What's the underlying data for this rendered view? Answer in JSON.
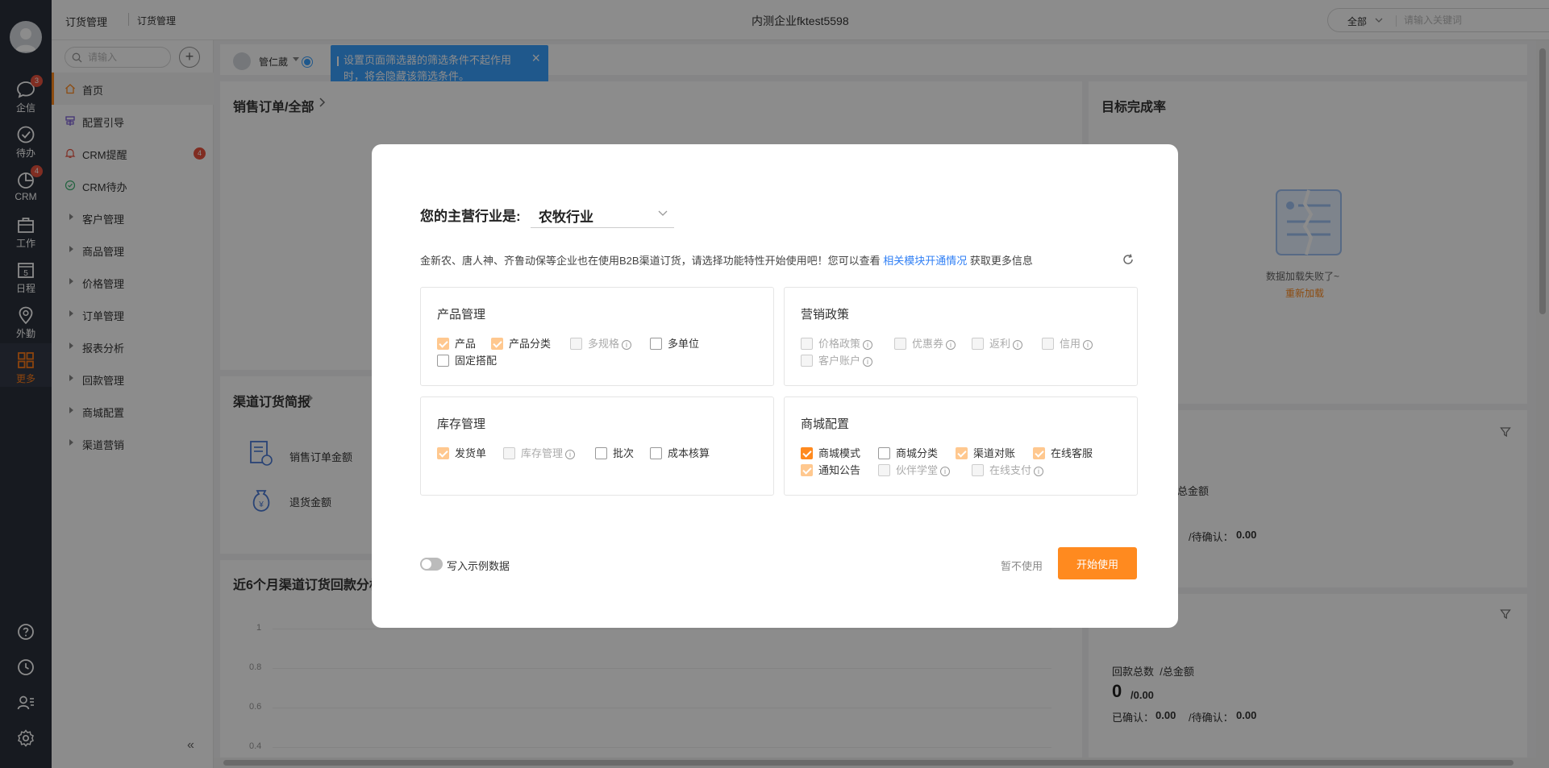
{
  "rail": {
    "items": [
      {
        "label": "企信",
        "badge": "3"
      },
      {
        "label": "待办",
        "badge": ""
      },
      {
        "label": "CRM",
        "badge": "4"
      },
      {
        "label": "工作",
        "badge": ""
      },
      {
        "label": "日程",
        "badge": ""
      },
      {
        "label": "外勤",
        "badge": ""
      },
      {
        "label": "更多",
        "badge": ""
      }
    ],
    "calendar_day": "5"
  },
  "topbar": {
    "breadcrumb_module": "订货管理",
    "breadcrumb_page": "订货管理",
    "company": "内测企业fktest5598",
    "search_scope": "全部",
    "search_placeholder": "请输入关键词"
  },
  "menu": {
    "search_placeholder": "请输入",
    "add_label": "+",
    "collapse_label": "«",
    "items": [
      {
        "label": "首页"
      },
      {
        "label": "配置引导"
      },
      {
        "label": "CRM提醒",
        "badge": "4"
      },
      {
        "label": "CRM待办"
      },
      {
        "label": "客户管理"
      },
      {
        "label": "商品管理"
      },
      {
        "label": "价格管理"
      },
      {
        "label": "订单管理"
      },
      {
        "label": "报表分析"
      },
      {
        "label": "回款管理"
      },
      {
        "label": "商城配置"
      },
      {
        "label": "渠道营销"
      }
    ]
  },
  "filterbar": {
    "user_name": "管仁葳"
  },
  "tip": {
    "text": "设置页面筛选器的筛选条件不起作用时，将会隐藏该筛选条件。",
    "close": "×"
  },
  "cards": {
    "sales_title": "销售订单/全部",
    "target_title": "目标完成率",
    "load_failed": "数据加载失败了~",
    "reload": "重新加载",
    "channel_title": "渠道订货简报",
    "channel_row1": "销售订单金额",
    "channel_row2": "退货金额",
    "chart_title": "近6个月渠道订货回款分析",
    "axis": [
      "1",
      "0.8",
      "0.6",
      "0.4"
    ],
    "right_mid_label": "总金额",
    "right_mid_pending": "/待确认：",
    "right_mid_pending_val": "0.00",
    "pay_total_label": "回款总数  /总金额",
    "pay_count": "0",
    "pay_amount": "/0.00",
    "pay_confirmed_label": "已确认：",
    "pay_confirmed_val": "0.00",
    "pay_pending_label": "/待确认：",
    "pay_pending_val": "0.00"
  },
  "modal": {
    "industry_label": "您的主营行业是:",
    "industry_value": "农牧行业",
    "desc_pre": "金新农、唐人神、齐鲁动保等企业也在使用B2B渠道订货，请选择功能特性开始使用吧！您可以查看",
    "desc_link": "相关模块开通情况",
    "desc_post": "获取更多信息",
    "sections": [
      {
        "title": "产品管理",
        "options": [
          "产品",
          "产品分类",
          "多规格",
          "多单位",
          "固定搭配"
        ]
      },
      {
        "title": "营销政策",
        "options": [
          "价格政策",
          "优惠券",
          "返利",
          "信用",
          "客户账户"
        ]
      },
      {
        "title": "库存管理",
        "options": [
          "发货单",
          "库存管理",
          "批次",
          "成本核算"
        ]
      },
      {
        "title": "商城配置",
        "options": [
          "商城模式",
          "商城分类",
          "渠道对账",
          "在线客服",
          "通知公告",
          "伙伴学堂",
          "在线支付"
        ]
      }
    ],
    "sample_toggle_label": "写入示例数据",
    "skip_label": "暂不使用",
    "start_label": "开始使用"
  },
  "colors": {
    "accent": "#ff8a1f",
    "link": "#2f7ff5",
    "rail_bg": "#2b303b",
    "tip_bg": "#3aa0ff"
  }
}
